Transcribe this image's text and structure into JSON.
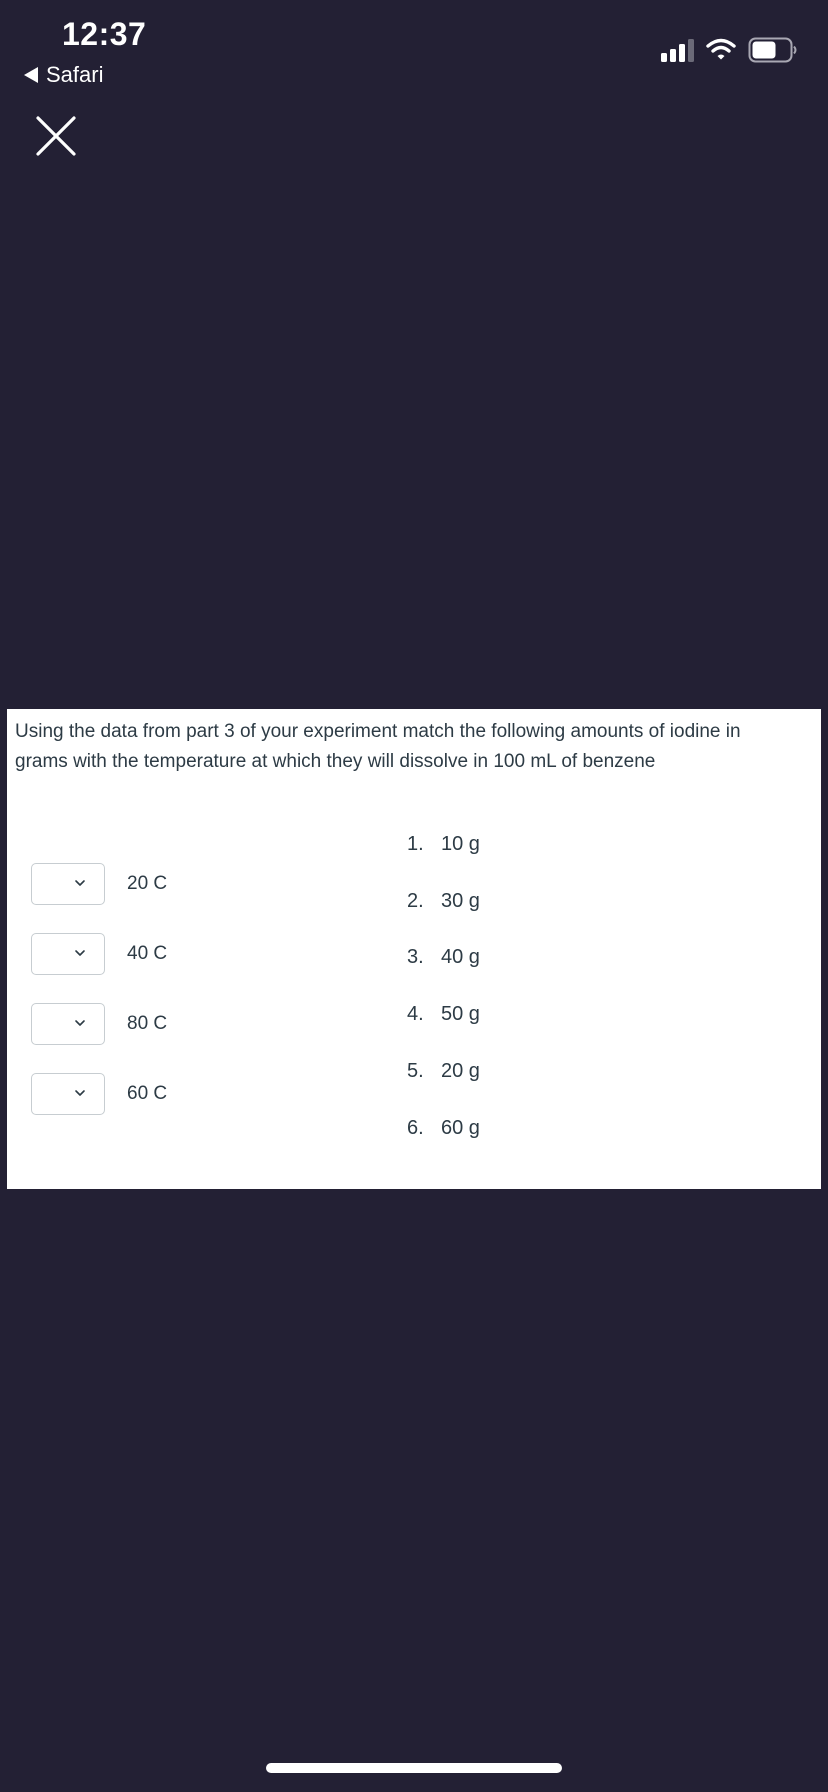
{
  "status_bar": {
    "time": "12:37",
    "back_label": "Safari",
    "icons": [
      "signal-icon",
      "wifi-icon",
      "battery-icon"
    ]
  },
  "toolbar": {
    "close_icon": "close-icon"
  },
  "question": {
    "text": "Using the data from part 3 of your experiment match the following amounts of iodine in grams with the temperature at which they will dissolve in 100 mL of benzene",
    "prompts": [
      {
        "selected": "",
        "label": "20 C"
      },
      {
        "selected": "",
        "label": "40 C"
      },
      {
        "selected": "",
        "label": "80 C"
      },
      {
        "selected": "",
        "label": "60 C"
      }
    ],
    "answers": [
      {
        "num": "1.",
        "value": "10 g"
      },
      {
        "num": "2.",
        "value": "30 g"
      },
      {
        "num": "3.",
        "value": "40 g"
      },
      {
        "num": "4.",
        "value": "50 g"
      },
      {
        "num": "5.",
        "value": "20 g"
      },
      {
        "num": "6.",
        "value": "60 g"
      }
    ]
  },
  "colors": {
    "background": "#232034",
    "panel": "#ffffff",
    "text": "#2d3b45",
    "select_border": "#c7cdd1"
  }
}
